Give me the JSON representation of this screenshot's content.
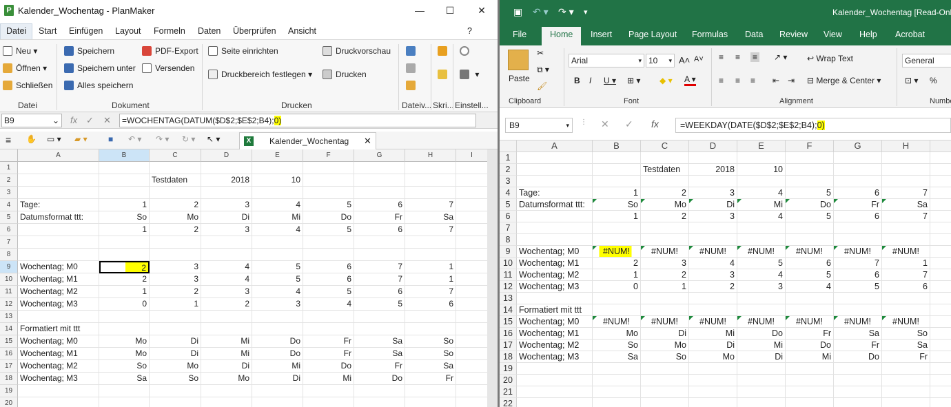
{
  "planmaker": {
    "title": "Kalender_Wochentag - PlanMaker",
    "app_icon": "P",
    "window_controls": {
      "minimize": "—",
      "maximize": "☐",
      "close": "✕"
    },
    "menu": [
      "Datei",
      "Start",
      "Einfügen",
      "Layout",
      "Formeln",
      "Daten",
      "Überprüfen",
      "Ansicht"
    ],
    "help": "?",
    "ribbon": {
      "datei": {
        "label": "Datei",
        "items": [
          "Neu",
          "Öffnen",
          "Schließen"
        ]
      },
      "dokument": {
        "label": "Dokument",
        "items": [
          "Speichern",
          "Speichern unter",
          "Alles speichern",
          "PDF-Export",
          "Versenden"
        ]
      },
      "drucken": {
        "label": "Drucken",
        "items": [
          "Seite einrichten",
          "Druckbereich festlegen",
          "Druckvorschau",
          "Drucken"
        ]
      },
      "dateiv": "Dateiv...",
      "skri": "Skri...",
      "einstell": "Einstell..."
    },
    "cellref": "B9",
    "fx": "fx",
    "formula_main": "=WOCHENTAG(DATUM($D$2;$E$2;B4);",
    "formula_hl": "0)",
    "doc_tab": "Kalender_Wochentag",
    "col_headers": [
      "A",
      "B",
      "C",
      "D",
      "E",
      "F",
      "G",
      "H",
      "I"
    ],
    "rows": [
      {
        "n": "1",
        "a": "",
        "v": [
          "",
          "",
          "",
          "",
          "",
          "",
          ""
        ]
      },
      {
        "n": "2",
        "a": "",
        "v": [
          "",
          "Testdaten",
          "2018",
          "10",
          "",
          "",
          ""
        ]
      },
      {
        "n": "3",
        "a": "",
        "v": [
          "",
          "",
          "",
          "",
          "",
          "",
          ""
        ]
      },
      {
        "n": "4",
        "a": "Tage:",
        "v": [
          "1",
          "2",
          "3",
          "4",
          "5",
          "6",
          "7"
        ]
      },
      {
        "n": "5",
        "a": "Datumsformat ttt:",
        "v": [
          "So",
          "Mo",
          "Di",
          "Mi",
          "Do",
          "Fr",
          "Sa"
        ]
      },
      {
        "n": "6",
        "a": "",
        "v": [
          "1",
          "2",
          "3",
          "4",
          "5",
          "6",
          "7"
        ]
      },
      {
        "n": "7",
        "a": "",
        "v": [
          "",
          "",
          "",
          "",
          "",
          "",
          ""
        ]
      },
      {
        "n": "8",
        "a": "",
        "v": [
          "",
          "",
          "",
          "",
          "",
          "",
          ""
        ]
      },
      {
        "n": "9",
        "a": "Wochentag; M0",
        "v": [
          "2",
          "3",
          "4",
          "5",
          "6",
          "7",
          "1"
        ]
      },
      {
        "n": "10",
        "a": "Wochentag; M1",
        "v": [
          "2",
          "3",
          "4",
          "5",
          "6",
          "7",
          "1"
        ]
      },
      {
        "n": "11",
        "a": "Wochentag; M2",
        "v": [
          "1",
          "2",
          "3",
          "4",
          "5",
          "6",
          "7"
        ]
      },
      {
        "n": "12",
        "a": "Wochentag; M3",
        "v": [
          "0",
          "1",
          "2",
          "3",
          "4",
          "5",
          "6"
        ]
      },
      {
        "n": "13",
        "a": "",
        "v": [
          "",
          "",
          "",
          "",
          "",
          "",
          ""
        ]
      },
      {
        "n": "14",
        "a": "Formatiert mit ttt",
        "v": [
          "",
          "",
          "",
          "",
          "",
          "",
          ""
        ]
      },
      {
        "n": "15",
        "a": "Wochentag; M0",
        "v": [
          "Mo",
          "Di",
          "Mi",
          "Do",
          "Fr",
          "Sa",
          "So"
        ]
      },
      {
        "n": "16",
        "a": "Wochentag; M1",
        "v": [
          "Mo",
          "Di",
          "Mi",
          "Do",
          "Fr",
          "Sa",
          "So"
        ]
      },
      {
        "n": "17",
        "a": "Wochentag; M2",
        "v": [
          "So",
          "Mo",
          "Di",
          "Mi",
          "Do",
          "Fr",
          "Sa"
        ]
      },
      {
        "n": "18",
        "a": "Wochentag; M3",
        "v": [
          "Sa",
          "So",
          "Mo",
          "Di",
          "Mi",
          "Do",
          "Fr"
        ]
      },
      {
        "n": "19",
        "a": "",
        "v": [
          "",
          "",
          "",
          "",
          "",
          "",
          ""
        ]
      },
      {
        "n": "20",
        "a": "",
        "v": [
          "",
          "",
          "",
          "",
          "",
          "",
          ""
        ]
      }
    ]
  },
  "excel": {
    "title": "Kalender_Wochentag  [Read-Only]",
    "tabs": [
      "File",
      "Home",
      "Insert",
      "Page Layout",
      "Formulas",
      "Data",
      "Review",
      "View",
      "Help",
      "Acrobat"
    ],
    "ribbon": {
      "paste": "Paste",
      "clipboard": "Clipboard",
      "font_name": "Arial",
      "font_size": "10",
      "font": "Font",
      "wrap_text": "Wrap Text",
      "merge_center": "Merge & Center",
      "alignment": "Alignment",
      "number_format": "General",
      "number": "Number"
    },
    "cellref": "B9",
    "fx": "fx",
    "formula_main": "=WEEKDAY(DATE($D$2;$E$2;B4);",
    "formula_hl": "0)",
    "col_headers": [
      "A",
      "B",
      "C",
      "D",
      "E",
      "F",
      "G",
      "H"
    ],
    "rows": [
      {
        "n": "1",
        "a": "",
        "v": [
          "",
          "",
          "",
          "",
          "",
          "",
          ""
        ]
      },
      {
        "n": "2",
        "a": "",
        "v": [
          "",
          "Testdaten",
          "2018",
          "10",
          "",
          "",
          ""
        ]
      },
      {
        "n": "3",
        "a": "",
        "v": [
          "",
          "",
          "",
          "",
          "",
          "",
          ""
        ]
      },
      {
        "n": "4",
        "a": "Tage:",
        "v": [
          "1",
          "2",
          "3",
          "4",
          "5",
          "6",
          "7"
        ]
      },
      {
        "n": "5",
        "a": "Datumsformat ttt:",
        "v": [
          "So",
          "Mo",
          "Di",
          "Mi",
          "Do",
          "Fr",
          "Sa"
        ]
      },
      {
        "n": "6",
        "a": "",
        "v": [
          "1",
          "2",
          "3",
          "4",
          "5",
          "6",
          "7"
        ]
      },
      {
        "n": "7",
        "a": "",
        "v": [
          "",
          "",
          "",
          "",
          "",
          "",
          ""
        ]
      },
      {
        "n": "8",
        "a": "",
        "v": [
          "",
          "",
          "",
          "",
          "",
          "",
          ""
        ]
      },
      {
        "n": "9",
        "a": "Wochentag; M0",
        "v": [
          "#NUM!",
          "#NUM!",
          "#NUM!",
          "#NUM!",
          "#NUM!",
          "#NUM!",
          "#NUM!"
        ]
      },
      {
        "n": "10",
        "a": "Wochentag; M1",
        "v": [
          "2",
          "3",
          "4",
          "5",
          "6",
          "7",
          "1"
        ]
      },
      {
        "n": "11",
        "a": "Wochentag; M2",
        "v": [
          "1",
          "2",
          "3",
          "4",
          "5",
          "6",
          "7"
        ]
      },
      {
        "n": "12",
        "a": "Wochentag; M3",
        "v": [
          "0",
          "1",
          "2",
          "3",
          "4",
          "5",
          "6"
        ]
      },
      {
        "n": "13",
        "a": "",
        "v": [
          "",
          "",
          "",
          "",
          "",
          "",
          ""
        ]
      },
      {
        "n": "14",
        "a": "Formatiert mit ttt",
        "v": [
          "",
          "",
          "",
          "",
          "",
          "",
          ""
        ]
      },
      {
        "n": "15",
        "a": "Wochentag; M0",
        "v": [
          "#NUM!",
          "#NUM!",
          "#NUM!",
          "#NUM!",
          "#NUM!",
          "#NUM!",
          "#NUM!"
        ]
      },
      {
        "n": "16",
        "a": "Wochentag; M1",
        "v": [
          "Mo",
          "Di",
          "Mi",
          "Do",
          "Fr",
          "Sa",
          "So"
        ]
      },
      {
        "n": "17",
        "a": "Wochentag; M2",
        "v": [
          "So",
          "Mo",
          "Di",
          "Mi",
          "Do",
          "Fr",
          "Sa"
        ]
      },
      {
        "n": "18",
        "a": "Wochentag; M3",
        "v": [
          "Sa",
          "So",
          "Mo",
          "Di",
          "Mi",
          "Do",
          "Fr"
        ]
      },
      {
        "n": "19",
        "a": "",
        "v": [
          "",
          "",
          "",
          "",
          "",
          "",
          ""
        ]
      },
      {
        "n": "20",
        "a": "",
        "v": [
          "",
          "",
          "",
          "",
          "",
          "",
          ""
        ]
      },
      {
        "n": "21",
        "a": "",
        "v": [
          "",
          "",
          "",
          "",
          "",
          "",
          ""
        ]
      },
      {
        "n": "22",
        "a": "",
        "v": [
          "",
          "",
          "",
          "",
          "",
          "",
          ""
        ]
      }
    ]
  },
  "colors": {
    "selection_fill": "#ffff00",
    "excel_green": "#217346",
    "error_triangle": "#1e8a3c"
  }
}
